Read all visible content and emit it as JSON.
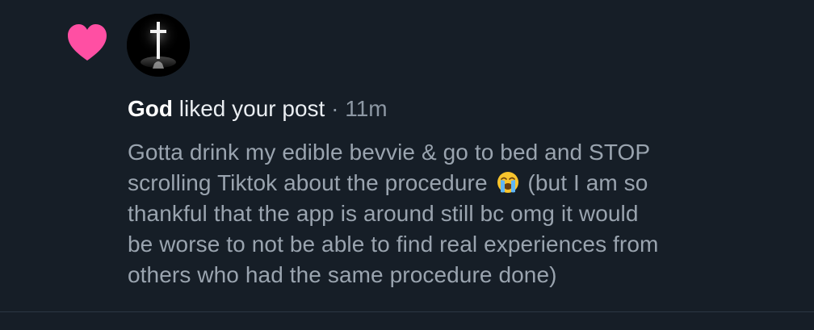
{
  "notification": {
    "actor": "God",
    "action": "liked your post",
    "separator": "·",
    "time": "11m",
    "icon": "heart-icon",
    "avatar": "cross-avatar",
    "colors": {
      "background": "#161e27",
      "heart": "#ff4fa3",
      "headline": "#e9edf1",
      "post_text": "#9aa4af"
    },
    "post_lines": [
      "Gotta drink my edible bevvie & go to bed and STOP",
      "scrolling Tiktok about the procedure",
      "(but I am so",
      "thankful that the app is around still bc omg it would",
      "be worse to not be able to find real experiences from",
      "others who had the same procedure done)"
    ],
    "emoji": "loudly-crying-face-icon"
  }
}
